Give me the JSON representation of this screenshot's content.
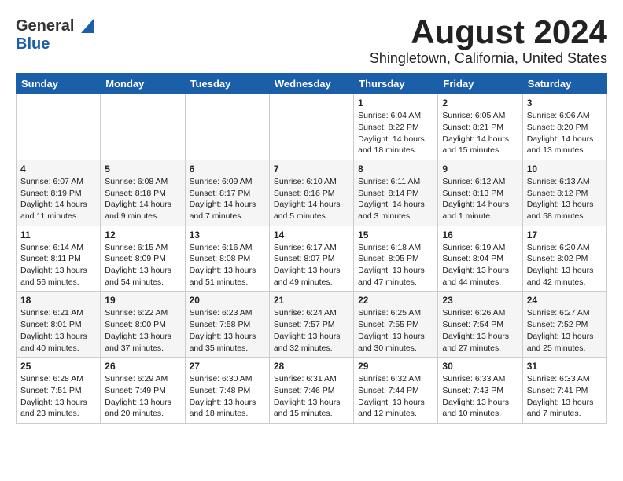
{
  "header": {
    "logo_general": "General",
    "logo_blue": "Blue",
    "title": "August 2024",
    "subtitle": "Shingletown, California, United States"
  },
  "weekdays": [
    "Sunday",
    "Monday",
    "Tuesday",
    "Wednesday",
    "Thursday",
    "Friday",
    "Saturday"
  ],
  "weeks": [
    [
      {
        "day": "",
        "text": ""
      },
      {
        "day": "",
        "text": ""
      },
      {
        "day": "",
        "text": ""
      },
      {
        "day": "",
        "text": ""
      },
      {
        "day": "1",
        "text": "Sunrise: 6:04 AM\nSunset: 8:22 PM\nDaylight: 14 hours\nand 18 minutes."
      },
      {
        "day": "2",
        "text": "Sunrise: 6:05 AM\nSunset: 8:21 PM\nDaylight: 14 hours\nand 15 minutes."
      },
      {
        "day": "3",
        "text": "Sunrise: 6:06 AM\nSunset: 8:20 PM\nDaylight: 14 hours\nand 13 minutes."
      }
    ],
    [
      {
        "day": "4",
        "text": "Sunrise: 6:07 AM\nSunset: 8:19 PM\nDaylight: 14 hours\nand 11 minutes."
      },
      {
        "day": "5",
        "text": "Sunrise: 6:08 AM\nSunset: 8:18 PM\nDaylight: 14 hours\nand 9 minutes."
      },
      {
        "day": "6",
        "text": "Sunrise: 6:09 AM\nSunset: 8:17 PM\nDaylight: 14 hours\nand 7 minutes."
      },
      {
        "day": "7",
        "text": "Sunrise: 6:10 AM\nSunset: 8:16 PM\nDaylight: 14 hours\nand 5 minutes."
      },
      {
        "day": "8",
        "text": "Sunrise: 6:11 AM\nSunset: 8:14 PM\nDaylight: 14 hours\nand 3 minutes."
      },
      {
        "day": "9",
        "text": "Sunrise: 6:12 AM\nSunset: 8:13 PM\nDaylight: 14 hours\nand 1 minute."
      },
      {
        "day": "10",
        "text": "Sunrise: 6:13 AM\nSunset: 8:12 PM\nDaylight: 13 hours\nand 58 minutes."
      }
    ],
    [
      {
        "day": "11",
        "text": "Sunrise: 6:14 AM\nSunset: 8:11 PM\nDaylight: 13 hours\nand 56 minutes."
      },
      {
        "day": "12",
        "text": "Sunrise: 6:15 AM\nSunset: 8:09 PM\nDaylight: 13 hours\nand 54 minutes."
      },
      {
        "day": "13",
        "text": "Sunrise: 6:16 AM\nSunset: 8:08 PM\nDaylight: 13 hours\nand 51 minutes."
      },
      {
        "day": "14",
        "text": "Sunrise: 6:17 AM\nSunset: 8:07 PM\nDaylight: 13 hours\nand 49 minutes."
      },
      {
        "day": "15",
        "text": "Sunrise: 6:18 AM\nSunset: 8:05 PM\nDaylight: 13 hours\nand 47 minutes."
      },
      {
        "day": "16",
        "text": "Sunrise: 6:19 AM\nSunset: 8:04 PM\nDaylight: 13 hours\nand 44 minutes."
      },
      {
        "day": "17",
        "text": "Sunrise: 6:20 AM\nSunset: 8:02 PM\nDaylight: 13 hours\nand 42 minutes."
      }
    ],
    [
      {
        "day": "18",
        "text": "Sunrise: 6:21 AM\nSunset: 8:01 PM\nDaylight: 13 hours\nand 40 minutes."
      },
      {
        "day": "19",
        "text": "Sunrise: 6:22 AM\nSunset: 8:00 PM\nDaylight: 13 hours\nand 37 minutes."
      },
      {
        "day": "20",
        "text": "Sunrise: 6:23 AM\nSunset: 7:58 PM\nDaylight: 13 hours\nand 35 minutes."
      },
      {
        "day": "21",
        "text": "Sunrise: 6:24 AM\nSunset: 7:57 PM\nDaylight: 13 hours\nand 32 minutes."
      },
      {
        "day": "22",
        "text": "Sunrise: 6:25 AM\nSunset: 7:55 PM\nDaylight: 13 hours\nand 30 minutes."
      },
      {
        "day": "23",
        "text": "Sunrise: 6:26 AM\nSunset: 7:54 PM\nDaylight: 13 hours\nand 27 minutes."
      },
      {
        "day": "24",
        "text": "Sunrise: 6:27 AM\nSunset: 7:52 PM\nDaylight: 13 hours\nand 25 minutes."
      }
    ],
    [
      {
        "day": "25",
        "text": "Sunrise: 6:28 AM\nSunset: 7:51 PM\nDaylight: 13 hours\nand 23 minutes."
      },
      {
        "day": "26",
        "text": "Sunrise: 6:29 AM\nSunset: 7:49 PM\nDaylight: 13 hours\nand 20 minutes."
      },
      {
        "day": "27",
        "text": "Sunrise: 6:30 AM\nSunset: 7:48 PM\nDaylight: 13 hours\nand 18 minutes."
      },
      {
        "day": "28",
        "text": "Sunrise: 6:31 AM\nSunset: 7:46 PM\nDaylight: 13 hours\nand 15 minutes."
      },
      {
        "day": "29",
        "text": "Sunrise: 6:32 AM\nSunset: 7:44 PM\nDaylight: 13 hours\nand 12 minutes."
      },
      {
        "day": "30",
        "text": "Sunrise: 6:33 AM\nSunset: 7:43 PM\nDaylight: 13 hours\nand 10 minutes."
      },
      {
        "day": "31",
        "text": "Sunrise: 6:33 AM\nSunset: 7:41 PM\nDaylight: 13 hours\nand 7 minutes."
      }
    ]
  ]
}
